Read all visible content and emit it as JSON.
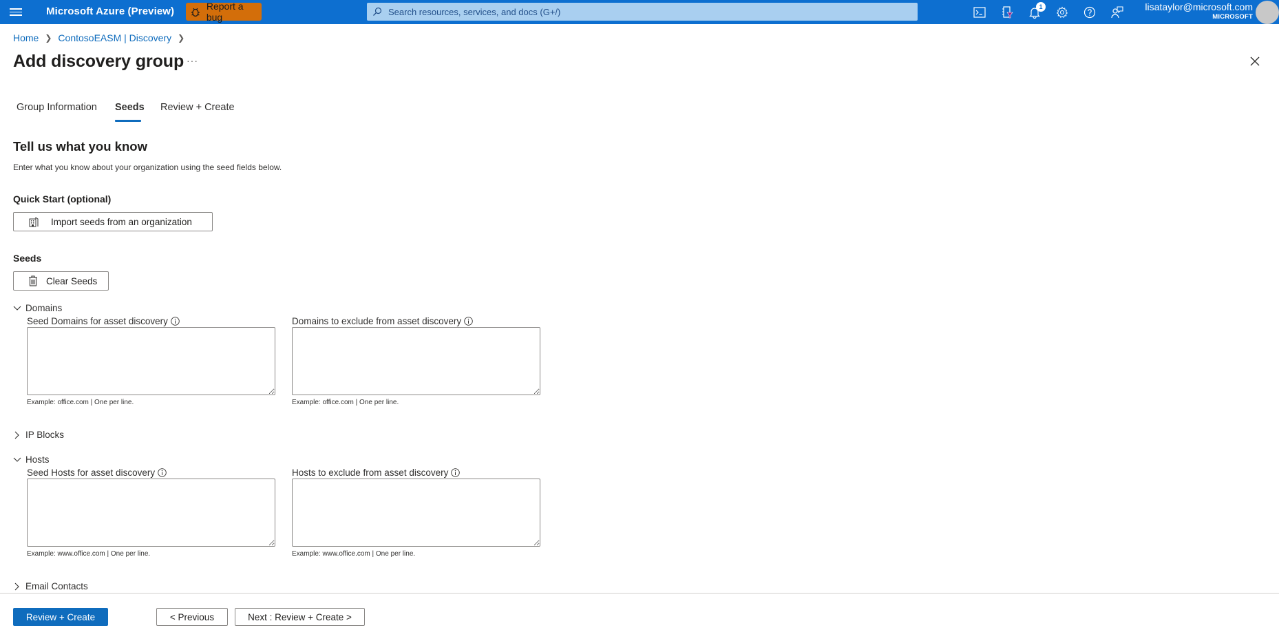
{
  "topbar": {
    "brand": "Microsoft Azure (Preview)",
    "report_bug_label": "Report a bug",
    "search_placeholder": "Search resources, services, and docs (G+/)",
    "icons": [
      "cloud-shell-icon",
      "directory-filter-icon",
      "notifications-icon",
      "settings-icon",
      "help-icon",
      "feedback-icon"
    ],
    "notification_count": "1",
    "user_email": "lisataylor@microsoft.com",
    "user_org": "MICROSOFT",
    "brand_color": "#0d6fd0",
    "bug_button_color": "#d36e0a"
  },
  "breadcrumb": {
    "items": [
      "Home",
      "ContosoEASM | Discovery"
    ]
  },
  "page": {
    "title": "Add discovery group",
    "more_label": "···"
  },
  "tabs": [
    {
      "label": "Group Information",
      "active": false
    },
    {
      "label": "Seeds",
      "active": true
    },
    {
      "label": "Review + Create",
      "active": false
    }
  ],
  "content": {
    "heading": "Tell us what you know",
    "description": "Enter what you know about your organization using the seed fields below.",
    "quick_start": {
      "heading": "Quick Start (optional)",
      "import_button": "Import seeds from an organization"
    },
    "seeds": {
      "heading": "Seeds",
      "clear_button": "Clear Seeds"
    },
    "sections": {
      "domains": {
        "label": "Domains",
        "expanded": true,
        "seed_label": "Seed Domains for asset discovery",
        "seed_value": "",
        "seed_example": "Example: office.com | One per line.",
        "exclude_label": "Domains to exclude from asset discovery",
        "exclude_value": "",
        "exclude_example": "Example: office.com | One per line."
      },
      "ip_blocks": {
        "label": "IP Blocks",
        "expanded": false
      },
      "hosts": {
        "label": "Hosts",
        "expanded": true,
        "seed_label": "Seed Hosts for asset discovery",
        "seed_value": "",
        "seed_example": "Example: www.office.com | One per line.",
        "exclude_label": "Hosts to exclude from asset discovery",
        "exclude_value": "",
        "exclude_example": "Example: www.office.com | One per line."
      },
      "email_contacts": {
        "label": "Email Contacts",
        "expanded": false
      }
    }
  },
  "footer": {
    "review_create": "Review + Create",
    "previous": "< Previous",
    "next": "Next : Review + Create >"
  }
}
